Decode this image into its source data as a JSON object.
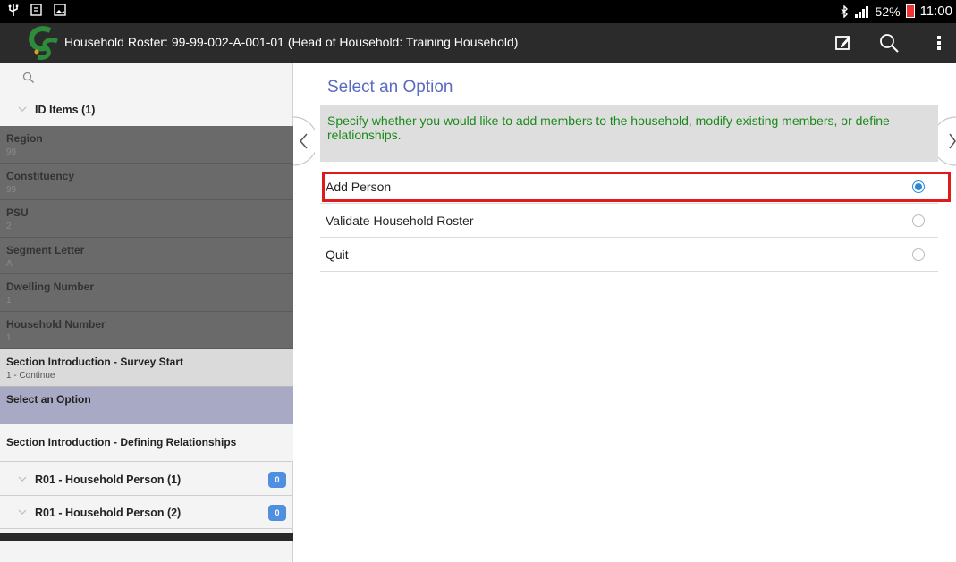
{
  "status_bar": {
    "usb_icon": "usb-icon",
    "notification_icons": [
      "screenshot-icon",
      "gallery-icon"
    ],
    "battery_percent": "52%",
    "time": "11:00"
  },
  "action_bar": {
    "title": "Household Roster: 99-99-002-A-001-01 (Head of Household: Training Household)",
    "icons": [
      "edit-icon",
      "search-icon",
      "overflow-menu-icon"
    ]
  },
  "sidebar": {
    "id_group_label": "ID Items (1)",
    "items": [
      {
        "title": "Region",
        "value": "99"
      },
      {
        "title": "Constituency",
        "value": "99"
      },
      {
        "title": "PSU",
        "value": "2"
      },
      {
        "title": "Segment Letter",
        "value": "A"
      },
      {
        "title": "Dwelling Number",
        "value": "1"
      },
      {
        "title": "Household Number",
        "value": "1"
      },
      {
        "title": "Section Introduction - Survey Start",
        "value": "1 - Continue"
      },
      {
        "title": "Select an Option",
        "value": ""
      },
      {
        "title": "Section Introduction - Defining Relationships",
        "value": ""
      }
    ],
    "groups": [
      {
        "label": "R01 - Household Person (1)",
        "count": "0"
      },
      {
        "label": "R01 - Household Person (2)",
        "count": "0"
      }
    ]
  },
  "main": {
    "title": "Select an Option",
    "prompt": "Specify whether you would like to add members to the household, modify existing members, or define relationships.",
    "options": [
      {
        "label": "Add Person",
        "selected": true
      },
      {
        "label": "Validate Household Roster",
        "selected": false
      },
      {
        "label": "Quit",
        "selected": false
      }
    ]
  },
  "colors": {
    "accent": "#5b6bc0",
    "prompt_text": "#1a8a1a",
    "highlight": "#e01919",
    "badge": "#4f8fe0"
  }
}
